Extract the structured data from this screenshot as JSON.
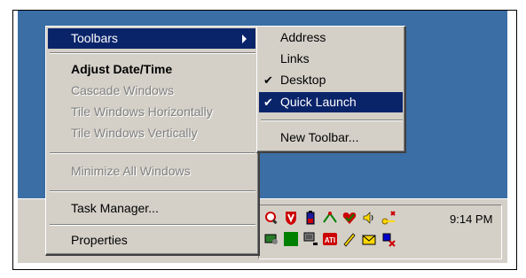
{
  "context_menu": {
    "items": [
      {
        "label": "Toolbars"
      },
      {
        "label": "Adjust Date/Time"
      },
      {
        "label": "Cascade Windows"
      },
      {
        "label": "Tile Windows Horizontally"
      },
      {
        "label": "Tile Windows Vertically"
      },
      {
        "label": "Minimize All Windows"
      },
      {
        "label": "Task Manager..."
      },
      {
        "label": "Properties"
      }
    ]
  },
  "toolbars_submenu": {
    "check_glyph": "✔",
    "items": [
      {
        "label": "Address"
      },
      {
        "label": "Links"
      },
      {
        "label": "Desktop"
      },
      {
        "label": "Quick Launch"
      },
      {
        "label": "New Toolbar..."
      }
    ]
  },
  "tray": {
    "time": "9:14 PM",
    "icons_row1": [
      "magnifier-q-icon",
      "shield-v-icon",
      "battery-icon",
      "network-icon",
      "antivirus-heart-icon",
      "volume-icon",
      "key-icon"
    ],
    "icons_row2": [
      "monitor-icon",
      "green-square-icon",
      "network-computer-icon",
      "ati-icon",
      "pen-icon",
      "envelope-icon",
      "disconnected-icon"
    ]
  },
  "colors": {
    "desktop": "#3a6ea5",
    "menu_bg": "#d4d0c8",
    "highlight": "#0a246a"
  }
}
